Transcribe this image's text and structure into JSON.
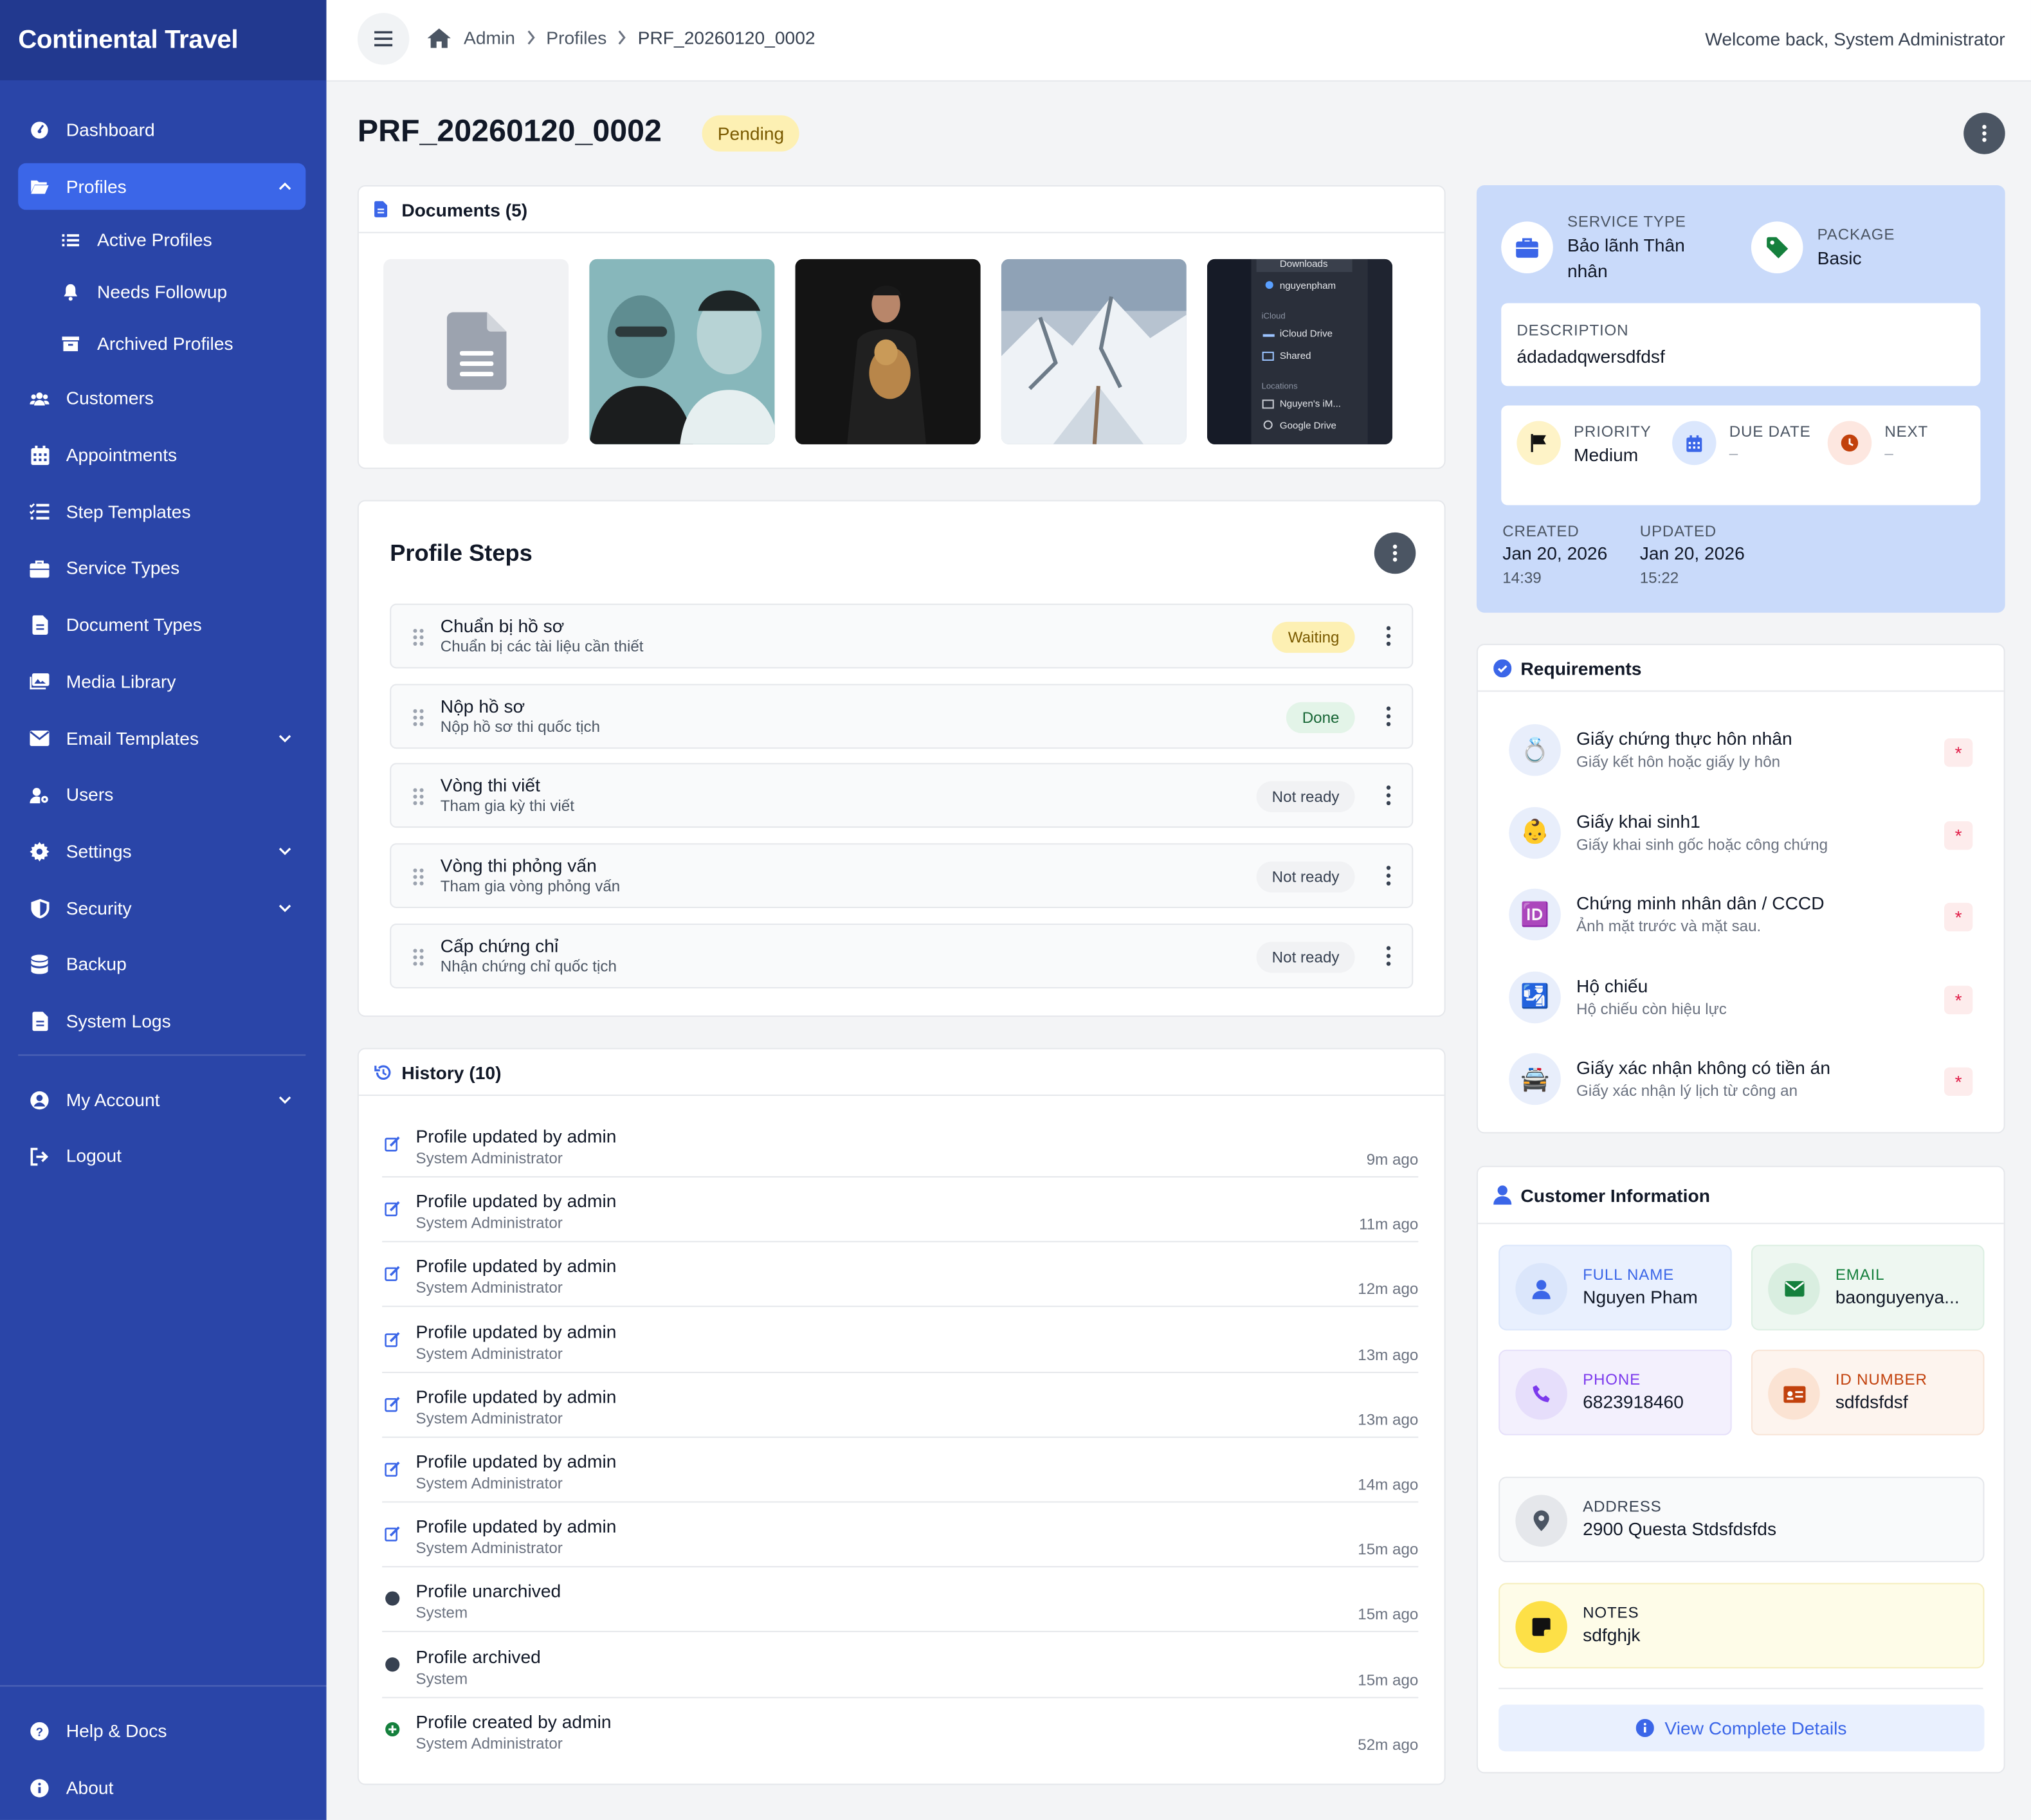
{
  "app": {
    "brand": "Continental Travel"
  },
  "sidebar": {
    "items": [
      {
        "label": "Dashboard"
      },
      {
        "label": "Profiles"
      },
      {
        "label": "Customers"
      },
      {
        "label": "Appointments"
      },
      {
        "label": "Step Templates"
      },
      {
        "label": "Service Types"
      },
      {
        "label": "Document Types"
      },
      {
        "label": "Media Library"
      },
      {
        "label": "Email Templates"
      },
      {
        "label": "Users"
      },
      {
        "label": "Settings"
      },
      {
        "label": "Security"
      },
      {
        "label": "Backup"
      },
      {
        "label": "System Logs"
      },
      {
        "label": "My Account"
      },
      {
        "label": "Logout"
      }
    ],
    "profiles_sub": [
      {
        "label": "Active Profiles"
      },
      {
        "label": "Needs Followup"
      },
      {
        "label": "Archived Profiles"
      }
    ],
    "bottom": [
      {
        "label": "Help & Docs"
      },
      {
        "label": "About"
      }
    ]
  },
  "topbar": {
    "breadcrumbs": [
      "Admin",
      "Profiles",
      "PRF_20260120_0002"
    ],
    "welcome": "Welcome back, System Administrator"
  },
  "profile": {
    "code": "PRF_20260120_0002",
    "status": "Pending"
  },
  "documents": {
    "title": "Documents (5)",
    "file_thumb_text": [
      "Downloads",
      "nguyenpham",
      "iCloud",
      "iCloud Drive",
      "Shared",
      "Locations",
      "Nguyen's iM...",
      "Google Drive"
    ]
  },
  "steps": {
    "title": "Profile Steps",
    "items": [
      {
        "title": "Chuẩn bị hồ sơ",
        "sub": "Chuẩn bị các tài liệu cần thiết",
        "status": "Waiting"
      },
      {
        "title": "Nộp hồ sơ",
        "sub": "Nộp hồ sơ thi quốc tịch",
        "status": "Done"
      },
      {
        "title": "Vòng thi viết",
        "sub": "Tham gia kỳ thi viết",
        "status": "Not ready"
      },
      {
        "title": "Vòng thi phỏng vấn",
        "sub": "Tham gia vòng phỏng vấn",
        "status": "Not ready"
      },
      {
        "title": "Cấp chứng chỉ",
        "sub": "Nhận chứng chỉ quốc tịch",
        "status": "Not ready"
      }
    ]
  },
  "history": {
    "title": "History (10)",
    "items": [
      {
        "title": "Profile updated by admin",
        "by": "System Administrator",
        "time": "9m ago",
        "icon": "edit-icon"
      },
      {
        "title": "Profile updated by admin",
        "by": "System Administrator",
        "time": "11m ago",
        "icon": "edit-icon"
      },
      {
        "title": "Profile updated by admin",
        "by": "System Administrator",
        "time": "12m ago",
        "icon": "edit-icon"
      },
      {
        "title": "Profile updated by admin",
        "by": "System Administrator",
        "time": "13m ago",
        "icon": "edit-icon"
      },
      {
        "title": "Profile updated by admin",
        "by": "System Administrator",
        "time": "13m ago",
        "icon": "edit-icon"
      },
      {
        "title": "Profile updated by admin",
        "by": "System Administrator",
        "time": "14m ago",
        "icon": "edit-icon"
      },
      {
        "title": "Profile updated by admin",
        "by": "System Administrator",
        "time": "15m ago",
        "icon": "edit-icon"
      },
      {
        "title": "Profile unarchived",
        "by": "System",
        "time": "15m ago",
        "icon": "dot-icon"
      },
      {
        "title": "Profile archived",
        "by": "System",
        "time": "15m ago",
        "icon": "dot-icon"
      },
      {
        "title": "Profile created by admin",
        "by": "System Administrator",
        "time": "52m ago",
        "icon": "plus-circle-icon"
      }
    ]
  },
  "summary": {
    "service_type_label": "SERVICE TYPE",
    "service_type_line1": "Bảo lãnh Thân",
    "service_type_line2": "nhân",
    "package_label": "PACKAGE",
    "package": "Basic",
    "description_label": "DESCRIPTION",
    "description": "ádadadqwersdfdsf",
    "priority_label": "PRIORITY",
    "priority": "Medium",
    "due_label": "DUE DATE",
    "due": "–",
    "next_label": "NEXT",
    "next": "–",
    "created_label": "CREATED",
    "created_date": "Jan 20, 2026",
    "created_time": "14:39",
    "updated_label": "UPDATED",
    "updated_date": "Jan 20, 2026",
    "updated_time": "15:22"
  },
  "requirements": {
    "title": "Requirements",
    "items": [
      {
        "title": "Giấy chứng thực hôn nhân",
        "sub": "Giấy kết hôn hoặc giấy ly hôn",
        "icon": "💍",
        "required": "*"
      },
      {
        "title": "Giấy khai sinh1",
        "sub": "Giấy khai sinh gốc hoặc công chứng",
        "icon": "👶",
        "required": "*"
      },
      {
        "title": "Chứng minh nhân dân / CCCD",
        "sub": "Ảnh mặt trước và mặt sau.",
        "icon": "🆔",
        "required": "*"
      },
      {
        "title": "Hộ chiếu",
        "sub": "Hộ chiếu còn hiệu lực",
        "icon": "🛂",
        "required": "*"
      },
      {
        "title": "Giấy xác nhận không có tiền án",
        "sub": "Giấy xác nhận lý lịch từ công an",
        "icon": "🚔",
        "required": "*"
      }
    ]
  },
  "customer": {
    "title": "Customer Information",
    "full_name_label": "FULL NAME",
    "full_name": "Nguyen Pham",
    "email_label": "EMAIL",
    "email": "baonguyenya...",
    "phone_label": "PHONE",
    "phone": "6823918460",
    "id_label": "ID NUMBER",
    "id_number": "sdfdsfdsf",
    "address_label": "ADDRESS",
    "address": "2900 Questa Stdsfdsfds",
    "notes_label": "NOTES",
    "notes": "sdfghjk",
    "view_details": "View Complete Details"
  },
  "colors": {
    "sidebar": "#2a45a8",
    "accent": "#3b66e8",
    "summary_bg": "#c9dafa"
  }
}
